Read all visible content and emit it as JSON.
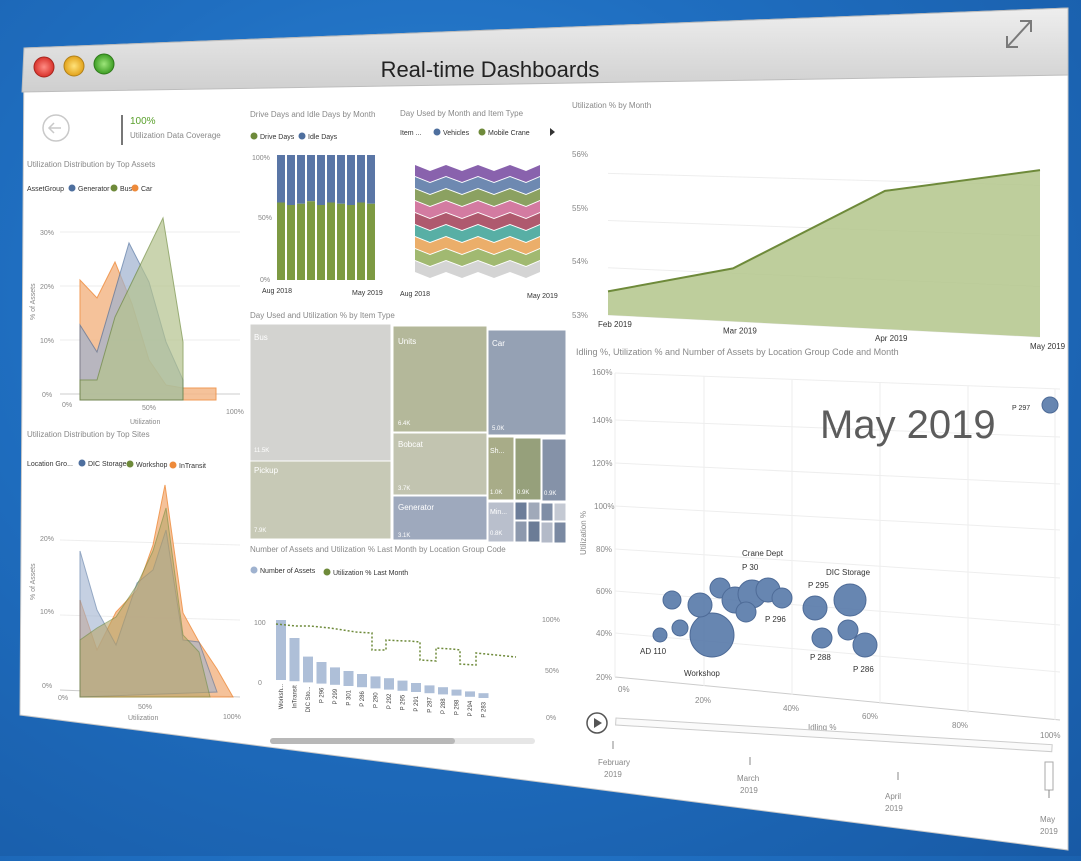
{
  "window": {
    "title": "Real-time Dashboards",
    "controls": [
      "close-button",
      "minimize-button",
      "zoom-button"
    ],
    "expand_icon": "expand-arrows-icon"
  },
  "coverage": {
    "value": "100%",
    "label": "Utilization Data Coverage"
  },
  "panel_assets": {
    "title": "Utilization Distribution by Top Assets",
    "legend_title": "AssetGroup",
    "legend": [
      {
        "name": "Generator",
        "color": "#4e6f9e"
      },
      {
        "name": "Bus",
        "color": "#6e8a3a"
      },
      {
        "name": "Car",
        "color": "#ee8a3a"
      }
    ],
    "y_ticks": [
      "30%",
      "20%",
      "10%",
      "0%"
    ],
    "x_ticks": [
      "0%",
      "50%",
      "100%"
    ],
    "ylabel": "% of Assets",
    "xlabel": "Utilization"
  },
  "panel_sites": {
    "title": "Utilization Distribution by Top Sites",
    "legend_title": "Location Gro...",
    "legend": [
      {
        "name": "DIC Storage",
        "color": "#4e6f9e"
      },
      {
        "name": "Workshop",
        "color": "#6e8a3a"
      },
      {
        "name": "InTransit",
        "color": "#ee8a3a"
      }
    ],
    "y_ticks": [
      "20%",
      "10%",
      "0%"
    ],
    "x_ticks": [
      "0%",
      "50%",
      "100%"
    ],
    "ylabel": "% of Assets",
    "xlabel": "Utilization"
  },
  "panel_drive": {
    "title": "Drive Days and Idle Days by Month",
    "legend": [
      {
        "name": "Drive Days",
        "color": "#6e8a3a"
      },
      {
        "name": "Idle Days",
        "color": "#4e6f9e"
      }
    ],
    "y_ticks": [
      "100%",
      "50%",
      "0%"
    ],
    "x_start": "Aug 2018",
    "x_end": "May 2019"
  },
  "panel_dayused": {
    "title": "Day Used by Month and Item Type",
    "legend_title": "Item ...",
    "legend": [
      {
        "name": "Vehicles",
        "color": "#4e6f9e"
      },
      {
        "name": "Mobile Crane",
        "color": "#6e8a3a"
      }
    ],
    "x_start": "Aug 2018",
    "x_end": "May 2019"
  },
  "panel_treemap": {
    "title": "Day Used and Utilization % by Item Type",
    "cells": [
      {
        "label": "Bus",
        "value": "11.5K"
      },
      {
        "label": "Pickup",
        "value": "7.9K"
      },
      {
        "label": "Units",
        "value": "6.4K"
      },
      {
        "label": "Car",
        "value": "5.0K"
      },
      {
        "label": "Bobcat",
        "value": "3.7K"
      },
      {
        "label": "Generator",
        "value": "3.1K"
      },
      {
        "label": "Sh...",
        "value": "1.0K"
      },
      {
        "label": "",
        "value": "0.9K"
      },
      {
        "label": "",
        "value": "0.9K"
      },
      {
        "label": "Min...",
        "value": "0.8K"
      }
    ]
  },
  "panel_assets_util": {
    "title": "Number of Assets and Utilization % Last Month by Location Group Code",
    "legend": [
      {
        "name": "Number of Assets",
        "color": "#9fb2cf"
      },
      {
        "name": "Utilization % Last Month",
        "color": "#6e8a3a"
      }
    ],
    "y_left": [
      "100",
      "0"
    ],
    "y_right": [
      "100%",
      "50%",
      "0%"
    ],
    "categories": [
      "Worksh...",
      "InTransit",
      "DIC Sto...",
      "P 296",
      "P 299",
      "P 301",
      "P 286",
      "P 290",
      "P 292",
      "P 295",
      "P 291",
      "P 287",
      "P 288",
      "P 298",
      "P 294",
      "P 283"
    ],
    "bars": [
      100,
      72,
      43,
      36,
      29,
      25,
      22,
      20,
      19,
      17,
      15,
      13,
      12,
      10,
      9,
      8
    ]
  },
  "chart_data": {
    "type": "area",
    "title": "Utilization % by Month",
    "categories": [
      "Feb 2019",
      "Mar 2019",
      "Apr 2019",
      "May 2019"
    ],
    "values": [
      53.5,
      54.1,
      55.8,
      56.3
    ],
    "ylim": [
      53,
      56.6
    ],
    "y_ticks": [
      "56%",
      "55%",
      "54%",
      "53%"
    ],
    "color": "#8fa85c"
  },
  "panel_bubble": {
    "title": "Idling %, Utilization % and Number of Assets by Location Group Code and Month",
    "big_label": "May 2019",
    "y_ticks": [
      "160%",
      "140%",
      "120%",
      "100%",
      "80%",
      "60%",
      "40%",
      "20%"
    ],
    "x_ticks": [
      "0%",
      "20%",
      "40%",
      "60%",
      "80%",
      "100%"
    ],
    "ylabel": "Utilization %",
    "xlabel": "Idling %",
    "labels": [
      "Crane Dept",
      "DIC Storage",
      "Workshop",
      "AD 110",
      "P 288",
      "P 286",
      "P 296",
      "P 295",
      "P 30",
      "P 297"
    ],
    "play_axis": [
      {
        "label": "February",
        "year": "2019"
      },
      {
        "label": "March",
        "year": "2019"
      },
      {
        "label": "April",
        "year": "2019"
      },
      {
        "label": "May",
        "year": "2019"
      }
    ]
  }
}
